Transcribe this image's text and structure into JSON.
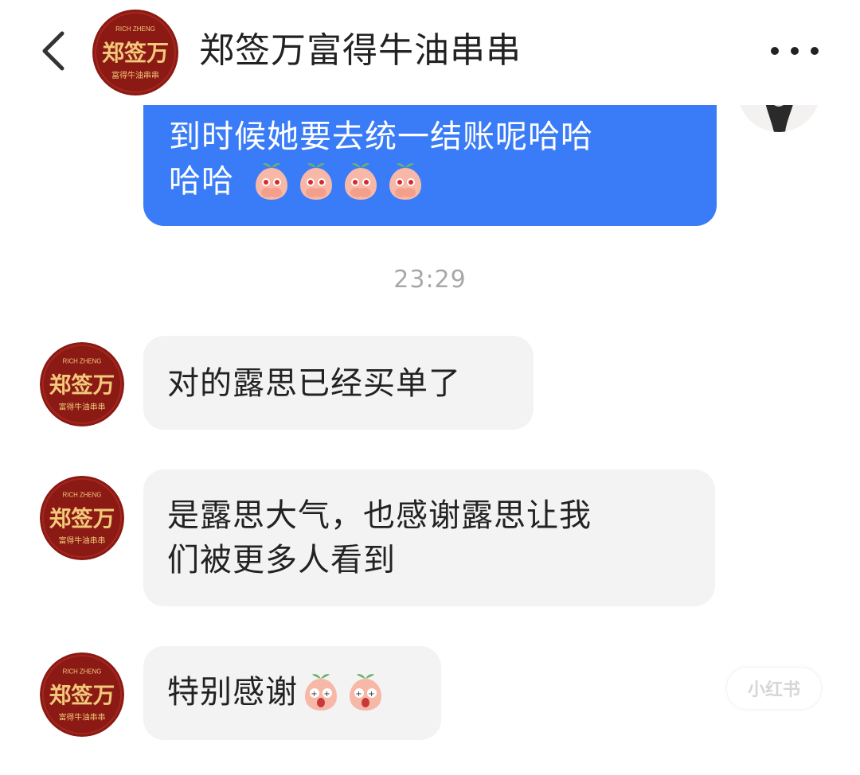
{
  "header": {
    "title": "郑签万富得牛油串串",
    "back_icon": "chevron-left-icon",
    "more_icon": "more-horizontal-icon",
    "logo": {
      "main": "郑签万",
      "top": "RICH ZHENG",
      "bottom": "富得牛油串串"
    }
  },
  "messages": [
    {
      "sender": "self",
      "lines": [
        "到时候她要去统一结账呢哈哈",
        "哈哈"
      ],
      "emoji_count": 4,
      "emoji": "peach-cover-face-emoji"
    },
    {
      "type": "timestamp",
      "text": "23:29"
    },
    {
      "sender": "shop",
      "lines": [
        "对的露思已经买单了"
      ]
    },
    {
      "sender": "shop",
      "lines": [
        "是露思大气，也感谢露思让我",
        "们被更多人看到"
      ]
    },
    {
      "sender": "shop",
      "lines": [
        "特别感谢"
      ],
      "emoji_count": 2,
      "emoji": "peach-excited-emoji"
    }
  ],
  "watermark": {
    "text": "小红书"
  },
  "colors": {
    "self_bubble": "#3a7cf7",
    "other_bubble": "#f3f3f3",
    "logo_red": "#8b1a14",
    "logo_gold": "#f2c97a",
    "timestamp": "#a8a8a8"
  }
}
